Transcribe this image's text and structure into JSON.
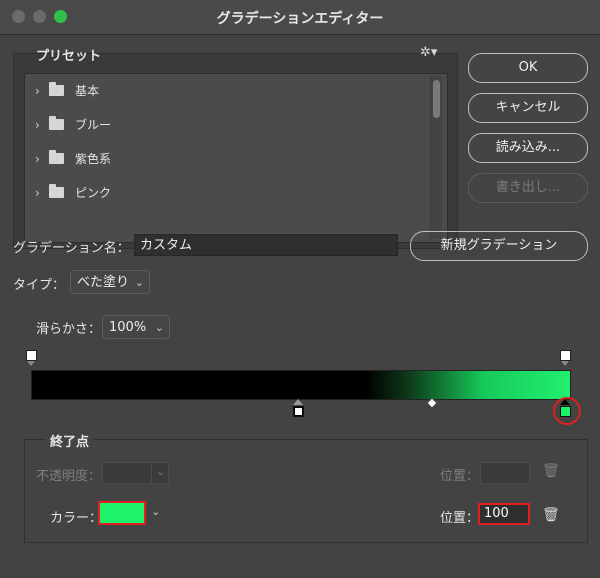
{
  "window": {
    "title": "グラデーションエディター"
  },
  "preset": {
    "label": "プリセット",
    "items": [
      {
        "label": "基本"
      },
      {
        "label": "ブルー"
      },
      {
        "label": "紫色系"
      },
      {
        "label": "ピンク"
      }
    ]
  },
  "buttons": {
    "ok": "OK",
    "cancel": "キャンセル",
    "load": "読み込み...",
    "save": "書き出し..."
  },
  "gradient_name": {
    "label": "グラデーション名：",
    "value": "カスタム",
    "new_button": "新規グラデーション"
  },
  "type": {
    "label": "タイプ：",
    "value": "べた塗り"
  },
  "smoothness": {
    "label": "滑らかさ：",
    "value": "100%"
  },
  "gradient": {
    "color_stops": [
      {
        "location_percent": 0,
        "color": "#000000"
      },
      {
        "location_percent": 100,
        "color": "#1ef26b",
        "selected": true
      }
    ],
    "opacity_stops": [
      {
        "location_percent": 0
      },
      {
        "location_percent": 100
      }
    ],
    "midpoint_percent": 50
  },
  "stop_section": {
    "title": "終了点",
    "opacity_label": "不透明度：",
    "opacity_position_label": "位置：",
    "color_label": "カラー：",
    "color_value": "#1ef26b",
    "color_position_label": "位置：",
    "color_position_value": "100"
  },
  "colors": {
    "highlight": "#e02020",
    "stop_green": "#1ef26b"
  }
}
